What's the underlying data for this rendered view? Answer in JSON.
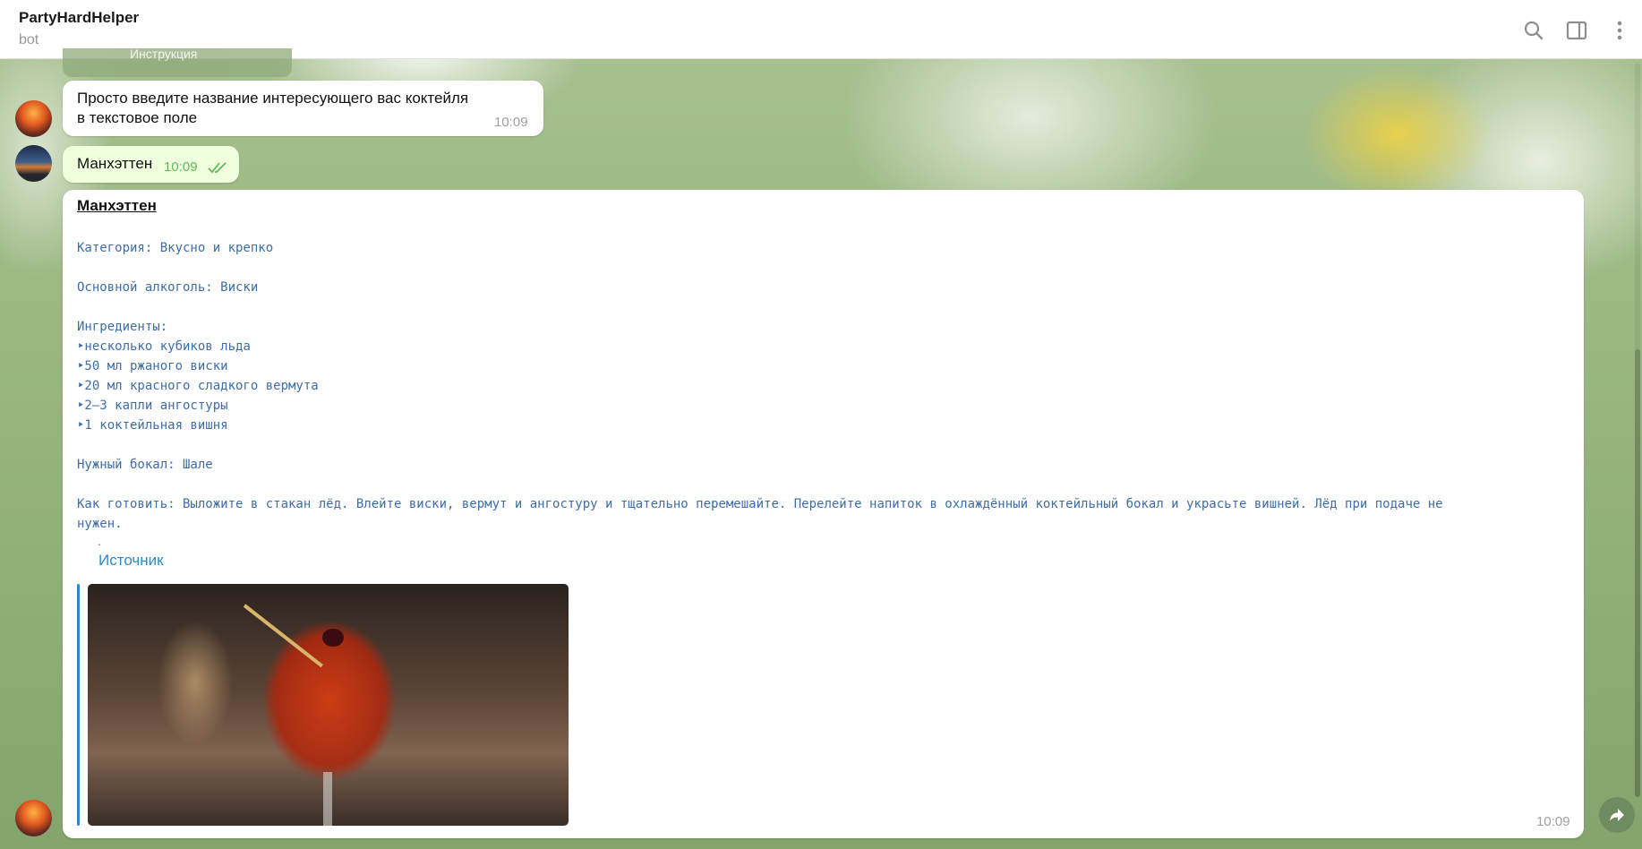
{
  "header": {
    "title": "PartyHardHelper",
    "subtitle": "bot",
    "icons": [
      "search-icon",
      "sidebar-toggle-icon",
      "more-vert-icon"
    ]
  },
  "partial_message": {
    "text": "Инструкция"
  },
  "messages": [
    {
      "text": "Просто введите название интересующего вас коктейля в текстовое поле",
      "time": "10:09"
    },
    {
      "text": "Манхэттен",
      "time": "10:09"
    }
  ],
  "card": {
    "title": "Манхэттен",
    "category": "Категория: Вкусно и крепко",
    "alcohol": "Основной алкоголь: Виски",
    "ingredients_label": "Ингредиенты:",
    "ingredients": [
      "‣несколько кубиков льда",
      "‣50 мл ржаного виски",
      "‣20 мл красного сладкого вермута",
      "‣2–3 капли ангостуры",
      "‣1 коктейльная вишня"
    ],
    "glass": "Нужный бокал: Шале",
    "howto_line1": "Как готовить: Выложите в стакан лёд. Влейте виски, вермут и ангостуру и тщательно перемешайте. Перелейте напиток в охлаждённый коктейльный бокал и украсьте вишней. Лёд при подаче не",
    "howto_line2": "нужен.",
    "dot": ".",
    "source_link": "Источник",
    "time": "10:09"
  },
  "colors": {
    "link": "#2e87c8",
    "mono_text": "#3f6da7",
    "outgoing_bubble": "#effedd",
    "check": "#5fb85a"
  }
}
